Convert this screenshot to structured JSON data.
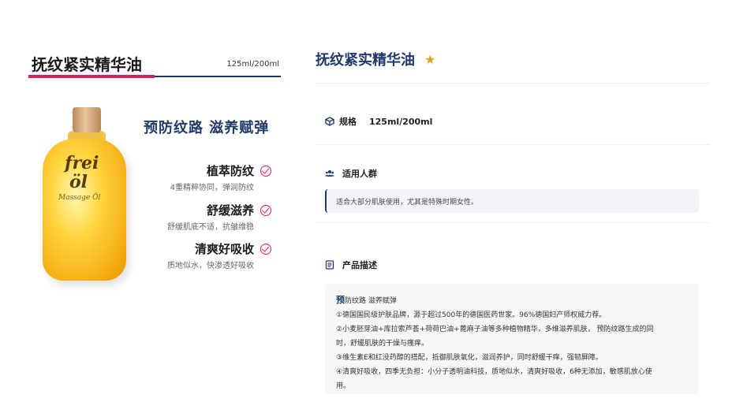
{
  "left": {
    "title": "抚纹紧实精华油",
    "size": "125ml/200ml",
    "headline": "预防纹路 滋养赋弹",
    "bottle": {
      "brand_top": "frei",
      "brand_bottom": "öl",
      "label": "Massage Öl"
    },
    "features": [
      {
        "title": "植萃防纹",
        "desc": "4重精粹协同，弹润防纹"
      },
      {
        "title": "舒缓滋养",
        "desc": "舒缓肌底不适，抗皱维稳"
      },
      {
        "title": "清爽好吸收",
        "desc": "质地似水，快渗透好吸收"
      }
    ]
  },
  "right": {
    "title": "抚纹紧实精华油",
    "spec_label": "规格",
    "spec_value": "125ml/200ml",
    "audience_label": "适用人群",
    "audience_text": "适合大部分肌肤使用，尤其是特殊时期女性。",
    "desc_label": "产品描述",
    "desc_first_bold": "预",
    "desc_first_rest": "防纹路 滋养赋弹",
    "desc_lines": [
      "①德国国民级护肤品牌，源于超过500年的德国医药世家。96%德国妇产师权威力荐。",
      "②小麦胚芽油+库拉索芦荟+荷荷巴油+蓖麻子油等多种植物精华，多维滋养肌肤， 预防纹路生成的同",
      "时，舒缓肌肤的干燥与瘙痒。",
      "③维生素E和红没药醇的搭配，抵御肌肤氧化，滋润养护，同时舒缓干痒，强韧屏障。",
      "④清爽好吸收，四季无负担：小分子透明油科技，质地似水，清爽好吸收，6种无添加，敏感肌放心使",
      "用。"
    ]
  },
  "colors": {
    "navy": "#1f3a68",
    "pink": "#d81e5b",
    "star": "#e0a51a"
  }
}
